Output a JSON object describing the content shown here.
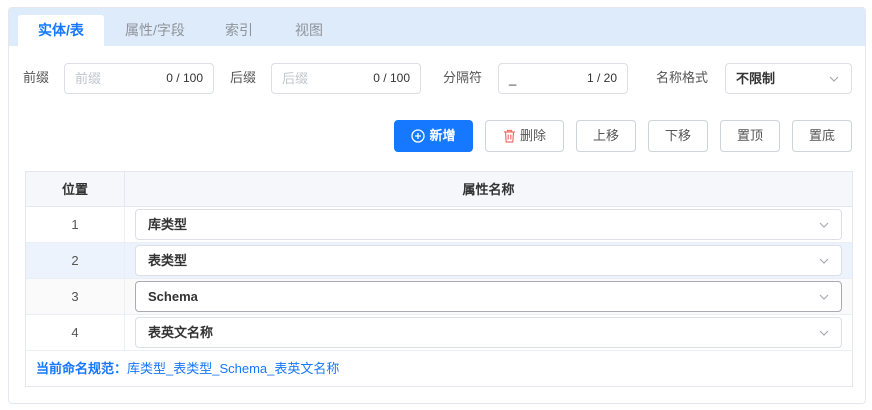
{
  "tabs": [
    {
      "label": "实体/表",
      "active": true
    },
    {
      "label": "属性/字段",
      "active": false
    },
    {
      "label": "索引",
      "active": false
    },
    {
      "label": "视图",
      "active": false
    }
  ],
  "form": {
    "prefix": {
      "label": "前缀",
      "placeholder": "前缀",
      "counter": "0 / 100"
    },
    "suffix": {
      "label": "后缀",
      "placeholder": "后缀",
      "counter": "0 / 100"
    },
    "separator": {
      "label": "分隔符",
      "value": "_",
      "counter": "1 / 20"
    },
    "name_format": {
      "label": "名称格式",
      "value": "不限制"
    }
  },
  "toolbar": {
    "add": "新增",
    "delete": "删除",
    "move_up": "上移",
    "move_down": "下移",
    "pin_top": "置顶",
    "pin_bottom": "置底"
  },
  "table": {
    "headers": {
      "position": "位置",
      "attr_name": "属性名称"
    },
    "rows": [
      {
        "pos": "1",
        "value": "库类型"
      },
      {
        "pos": "2",
        "value": "表类型"
      },
      {
        "pos": "3",
        "value": "Schema"
      },
      {
        "pos": "4",
        "value": "表英文名称"
      }
    ]
  },
  "rule": {
    "label": "当前命名规范：",
    "value": "库类型_表类型_Schema_表英文名称"
  },
  "colors": {
    "accent": "#1677ff",
    "tabbar_bg": "#deebfa",
    "delete_icon": "#f56c6c"
  }
}
